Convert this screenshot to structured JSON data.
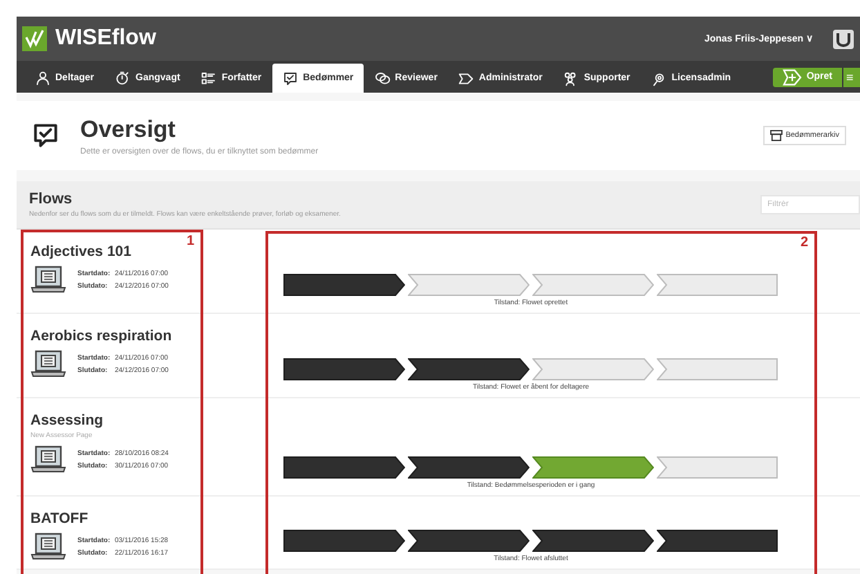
{
  "header": {
    "logo_text": "WISEflow",
    "user": "Jonas Friis-Jeppesen",
    "user_caret": "∨"
  },
  "nav": {
    "tabs": [
      {
        "label": "Deltager",
        "selected": false
      },
      {
        "label": "Gangvagt",
        "selected": false
      },
      {
        "label": "Forfatter",
        "selected": false
      },
      {
        "label": "Bedømmer",
        "selected": true
      },
      {
        "label": "Reviewer",
        "selected": false
      },
      {
        "label": "Administrator",
        "selected": false
      },
      {
        "label": "Supporter",
        "selected": false
      },
      {
        "label": "Licensadmin",
        "selected": false
      }
    ],
    "create_button": "Opret",
    "menu_button": "≡"
  },
  "overview": {
    "title": "Oversigt",
    "subtitle": "Dette er oversigten over de flows, du er tilknyttet som bedømmer",
    "archive_button": "Bedømmerarkiv"
  },
  "flows_section": {
    "title": "Flows",
    "subtitle": "Nedenfor ser du flows som du er tilmeldt. Flows kan være enkeltstående prøver, forløb og eksamener.",
    "filter_placeholder": "Filtrér"
  },
  "flows": [
    {
      "name": "Adjectives 101",
      "start_label": "Startdato:",
      "start": "24/11/2016 07:00",
      "end_label": "Slutdato:",
      "end": "24/12/2016 07:00",
      "steps": [
        {
          "kind": "done"
        },
        {
          "kind": "pending"
        },
        {
          "kind": "pending"
        },
        {
          "kind": "pending"
        }
      ],
      "status": "Tilstand: Flowet oprettet"
    },
    {
      "name": "Aerobics respiration",
      "start_label": "Startdato:",
      "start": "24/11/2016 07:00",
      "end_label": "Slutdato:",
      "end": "24/12/2016 07:00",
      "steps": [
        {
          "kind": "done"
        },
        {
          "kind": "done"
        },
        {
          "kind": "pending"
        },
        {
          "kind": "pending"
        }
      ],
      "status": "Tilstand: Flowet er åbent for deltagere"
    },
    {
      "name": "Assessing",
      "note": "New Assessor Page",
      "start_label": "Startdato:",
      "start": "28/10/2016 08:24",
      "end_label": "Slutdato:",
      "end": "30/11/2016 07:00",
      "steps": [
        {
          "kind": "done"
        },
        {
          "kind": "done"
        },
        {
          "kind": "active"
        },
        {
          "kind": "pending"
        }
      ],
      "status": "Tilstand: Bedømmelsesperioden er i gang"
    },
    {
      "name": "BATOFF",
      "start_label": "Startdato:",
      "start": "03/11/2016 15:28",
      "end_label": "Slutdato:",
      "end": "22/11/2016 16:17",
      "steps": [
        {
          "kind": "done"
        },
        {
          "kind": "done"
        },
        {
          "kind": "done"
        },
        {
          "kind": "done"
        }
      ],
      "status": "Tilstand: Flowet afsluttet"
    }
  ],
  "annotations": [
    {
      "label": "1",
      "kind": "names"
    },
    {
      "label": "2",
      "kind": "states"
    }
  ]
}
